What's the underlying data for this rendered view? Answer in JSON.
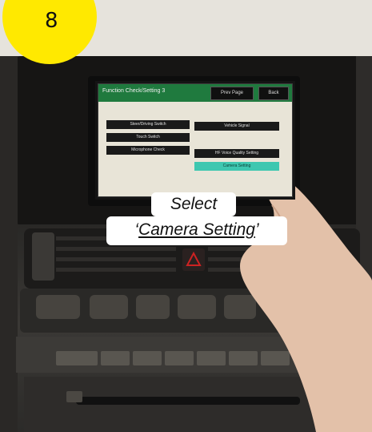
{
  "step": {
    "number": "8"
  },
  "screen": {
    "title": "Function Check/Setting 3",
    "header_buttons": [
      "Prev Page",
      "Back"
    ],
    "menu_left": [
      "Steer/Driving Switch",
      "Touch Switch",
      "Microphone Check"
    ],
    "menu_right": [
      "Vehicle Signal",
      "HF Voice Quality Setting",
      "Camera Setting"
    ]
  },
  "caption": {
    "line1": "Select",
    "quote_open": "‘",
    "highlight": "Camera Setting",
    "quote_close": "’"
  },
  "colors": {
    "badge": "#ffe900",
    "screen_header": "#1f7a3e",
    "selected_item": "#3ec7b0"
  }
}
